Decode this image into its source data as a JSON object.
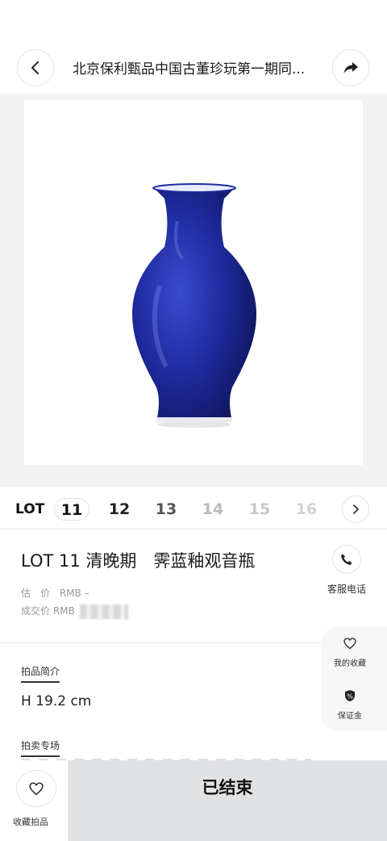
{
  "header": {
    "title": "北京保利甄品中国古董珍玩第一期同...",
    "back_icon": "chevron-left-icon",
    "share_icon": "share-arrow-icon"
  },
  "lot_bar": {
    "label": "LOT",
    "numbers": [
      "11",
      "12",
      "13",
      "14",
      "15",
      "16"
    ],
    "active": "11",
    "next_icon": "chevron-right-icon"
  },
  "lot_detail": {
    "title": "LOT 11 清晚期　霁蓝釉观音瓶",
    "estimate_label": "估　价",
    "estimate_value": "RMB –",
    "sold_label": "成交价",
    "sold_value": "RMB"
  },
  "service": {
    "label": "客服电话",
    "icon": "phone-icon"
  },
  "float_panel": {
    "favorites_label": "我的收藏",
    "favorites_icon": "heart-icon",
    "deposit_label": "保证金",
    "deposit_icon": "percent-badge-icon"
  },
  "sections": {
    "intro_title": "拍品简介",
    "dimension": "H 19.2 cm",
    "auction_title": "拍卖专场"
  },
  "bottom_bar": {
    "fav_label": "收藏拍品",
    "ended_label": "已结束"
  },
  "colors": {
    "vase": "#1e2a9e",
    "bottom_button": "#e1e2e4"
  }
}
